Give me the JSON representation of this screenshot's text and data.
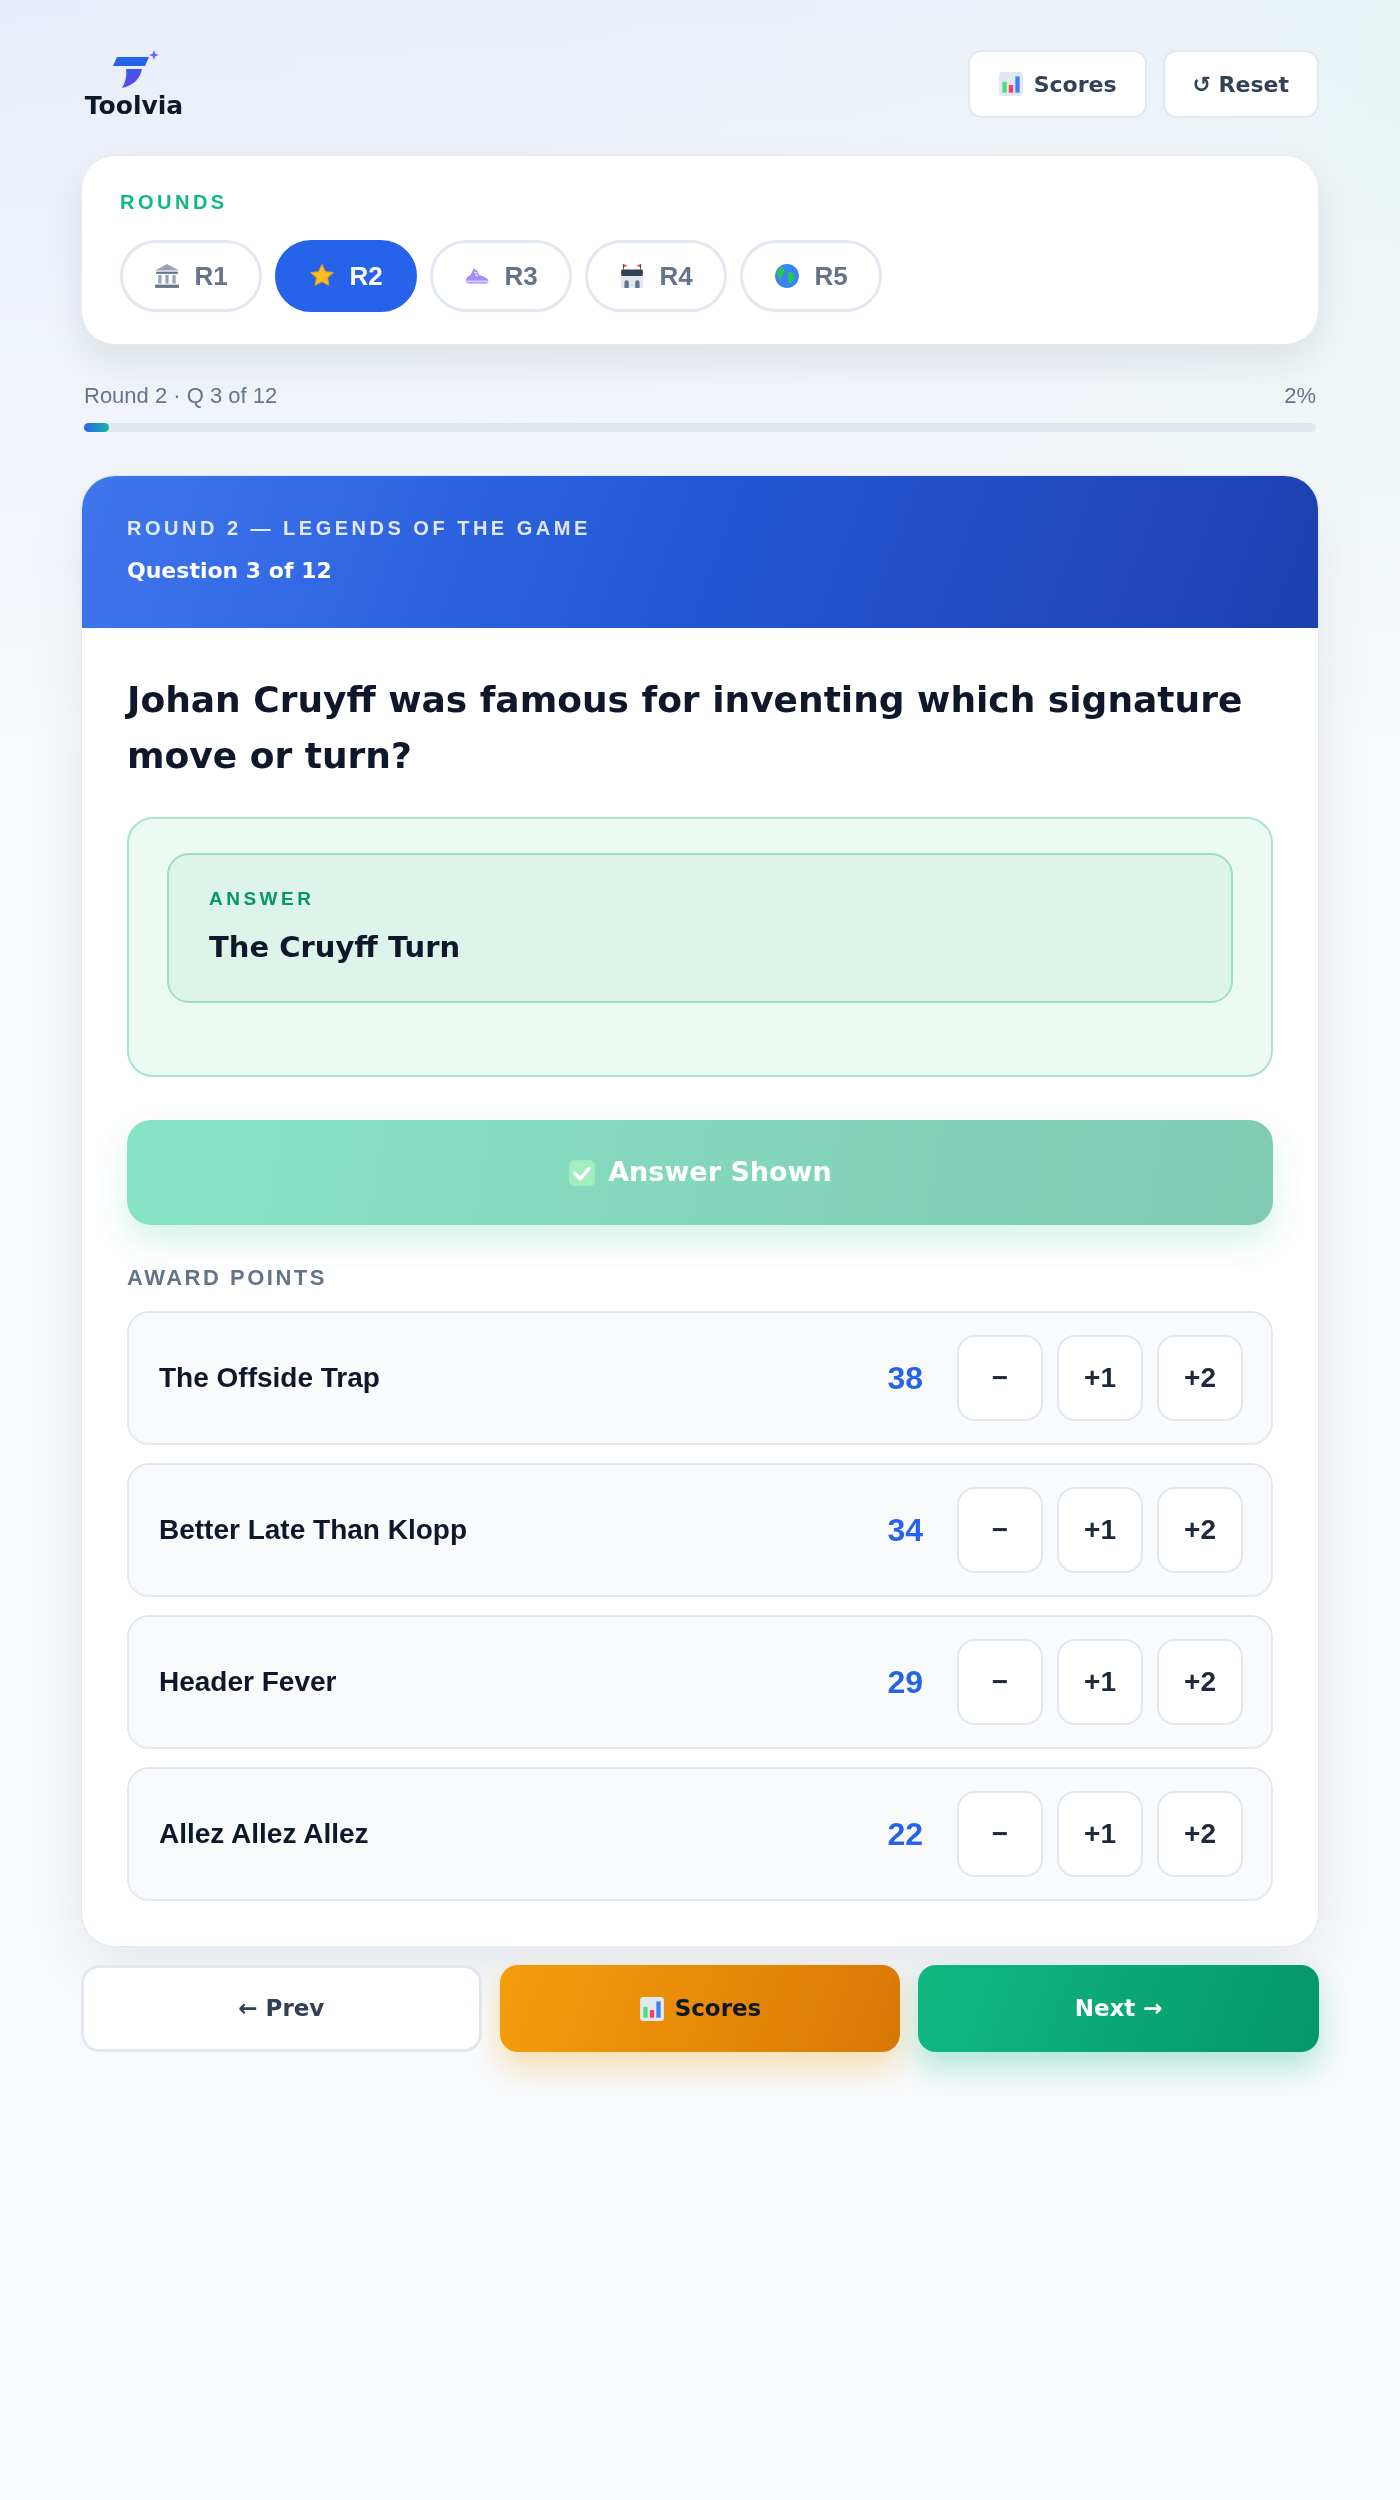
{
  "header": {
    "logo": "Toolvia",
    "buttons": [
      {
        "kind": "scores",
        "label": "Scores"
      },
      {
        "kind": "reset",
        "label": "↺ Reset"
      }
    ]
  },
  "rounds": {
    "title": "ROUNDS",
    "items": [
      {
        "label": "R1",
        "selected": false
      },
      {
        "label": "R2",
        "selected": true
      },
      {
        "label": "R3",
        "selected": false
      },
      {
        "label": "R4",
        "selected": false
      },
      {
        "label": "R5",
        "selected": false
      }
    ]
  },
  "progress": {
    "label": "Round 2 · Q 3 of 12",
    "percent": "2%",
    "level": 0.02
  },
  "question_card": {
    "round_title": "ROUND 2 — LEGENDS OF THE GAME",
    "question_number": "Question 3 of 12",
    "question": "Johan Cruyff was famous for inventing which signature move or turn?",
    "answer": {
      "label": "ANSWER",
      "text": "The Cruyff Turn"
    },
    "reveal_button": {
      "label": "Answer Shown",
      "disabled": true
    },
    "award_points": {
      "title": "AWARD POINTS",
      "teams": [
        {
          "name": "The Offside Trap",
          "score": "38",
          "buttons": [
            "−",
            "+1",
            "+2"
          ]
        },
        {
          "name": "Better Late Than Klopp",
          "score": "34",
          "buttons": [
            "−",
            "+1",
            "+2"
          ]
        },
        {
          "name": "Header Fever",
          "score": "29",
          "buttons": [
            "−",
            "+1",
            "+2"
          ]
        },
        {
          "name": "Allez Allez Allez",
          "score": "22",
          "buttons": [
            "−",
            "+1",
            "+2"
          ]
        }
      ]
    }
  },
  "nav": [
    {
      "kind": "prev",
      "label": "← Prev"
    },
    {
      "kind": "scores",
      "label": "Scores"
    },
    {
      "kind": "next",
      "label": "Next →"
    }
  ]
}
